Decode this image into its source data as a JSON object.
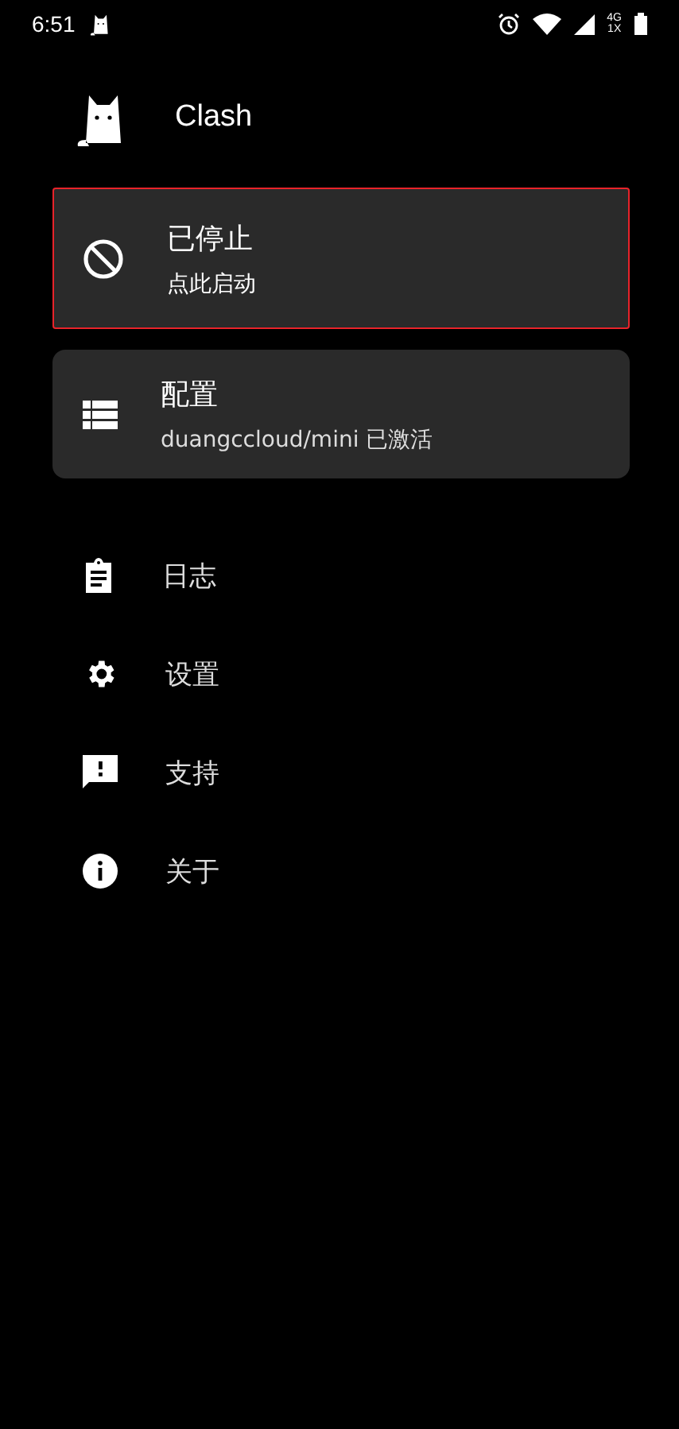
{
  "status_bar": {
    "time": "6:51",
    "network_top": "4G",
    "network_bottom": "1X"
  },
  "header": {
    "title": "Clash"
  },
  "cards": [
    {
      "kind": "status",
      "title": "已停止",
      "subtitle": "点此启动",
      "highlighted": true
    },
    {
      "kind": "profile",
      "title": "配置",
      "subtitle": "duangccloud/mini 已激活",
      "highlighted": false
    }
  ],
  "menu": [
    {
      "kind": "logs",
      "label": "日志"
    },
    {
      "kind": "settings",
      "label": "设置"
    },
    {
      "kind": "support",
      "label": "支持"
    },
    {
      "kind": "about",
      "label": "关于"
    }
  ]
}
